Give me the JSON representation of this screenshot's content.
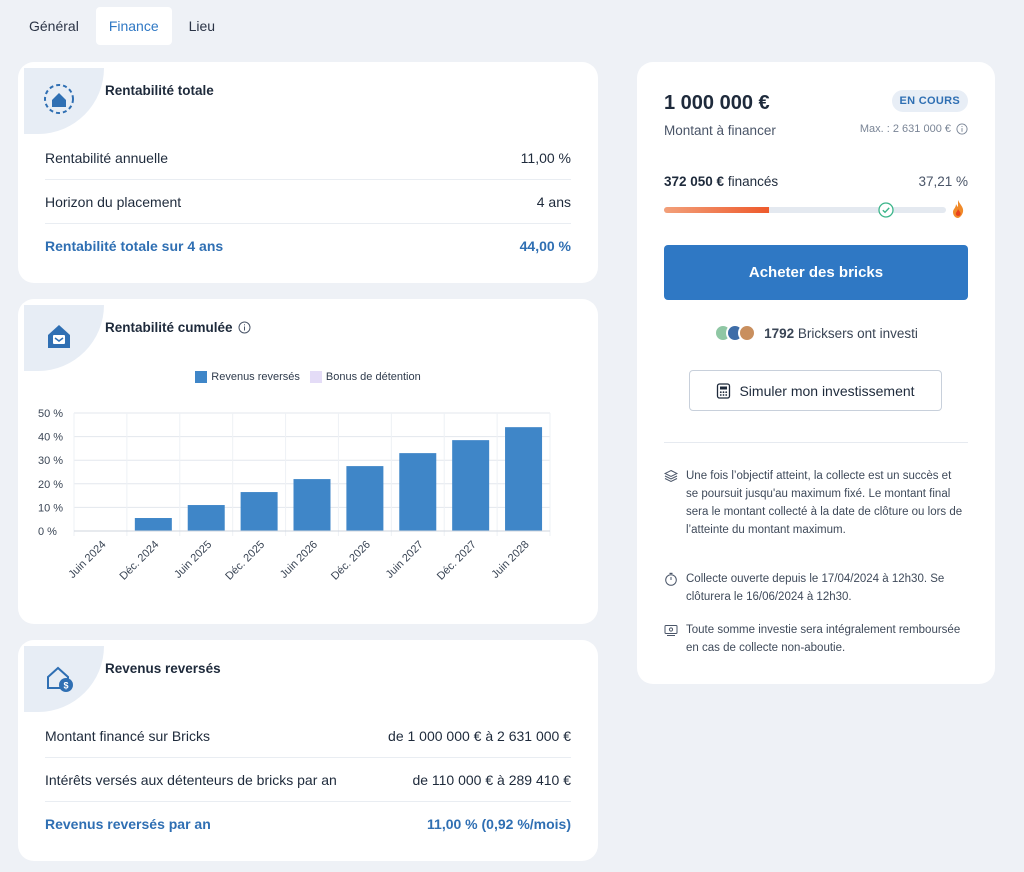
{
  "tabs": [
    {
      "label": "Général"
    },
    {
      "label": "Finance"
    },
    {
      "label": "Lieu"
    }
  ],
  "rentabilite": {
    "title": "Rentabilité totale",
    "rows": [
      {
        "label": "Rentabilité annuelle",
        "value": "11,00 %"
      },
      {
        "label": "Horizon du placement",
        "value": "4 ans"
      },
      {
        "label": "Rentabilité totale sur 4 ans",
        "value": "44,00 %"
      }
    ]
  },
  "cumulee": {
    "title": "Rentabilité cumulée",
    "info_icon": "info-circle-icon"
  },
  "chart_data": {
    "type": "bar",
    "categories": [
      "Juin 2024",
      "Déc. 2024",
      "Juin 2025",
      "Déc. 2025",
      "Juin 2026",
      "Déc. 2026",
      "Juin 2027",
      "Déc. 2027",
      "Juin 2028"
    ],
    "series": [
      {
        "name": "Revenus reversés",
        "color": "#3f86c8",
        "values": [
          0,
          5.5,
          11,
          16.5,
          22,
          27.5,
          33,
          38.5,
          44
        ]
      },
      {
        "name": "Bonus de détention",
        "color": "#e4dcf7",
        "values": [
          0,
          0,
          0,
          0,
          0,
          0,
          0,
          0,
          0
        ]
      }
    ],
    "y_ticks": [
      "0 %",
      "10 %",
      "20 %",
      "30 %",
      "40 %",
      "50 %"
    ],
    "ylim": [
      0,
      50
    ],
    "grid": true,
    "legend": "top-center"
  },
  "revenus": {
    "title": "Revenus reversés",
    "rows": [
      {
        "label": "Montant financé sur Bricks",
        "value": "de 1 000 000 € à 2 631 000 €"
      },
      {
        "label": "Intérêts versés aux détenteurs de bricks par an",
        "value": "de 110 000 € à 289 410 €"
      },
      {
        "label": "Revenus reversés par an",
        "value": "11,00 % (0,92 %/mois)"
      }
    ]
  },
  "funding": {
    "amount": "1 000 000 €",
    "status": "EN COURS",
    "amount_label": "Montant à financer",
    "max_label": "Max. : 2 631 000 €",
    "funded_amount": "372 050 €",
    "funded_suffix": "financés",
    "funded_pct_text": "37,21 %",
    "progress": 0.3721,
    "buy_button": "Acheter des bricks",
    "investors_count": "1792",
    "investors_text": "Bricksers ont investi",
    "simulate_button": "Simuler mon investissement",
    "info": [
      {
        "icon": "layers-icon",
        "text": "Une fois l’objectif atteint, la collecte est un succès et se poursuit jusqu'au maximum fixé. Le montant final sera le montant collecté à la date de clôture ou lors de l’atteinte du montant maximum."
      },
      {
        "icon": "stopwatch-icon",
        "text": "Collecte ouverte depuis le 17/04/2024 à 12h30. Se clôturera le 16/06/2024 à 12h30."
      },
      {
        "icon": "refund-icon",
        "text": "Toute somme investie sera intégralement remboursée en cas de collecte non-aboutie."
      }
    ],
    "colors": {
      "accent": "#2f78c4",
      "progress_start": "#f2a07a",
      "progress_end": "#ee5a2c",
      "check": "#3bb58a"
    }
  }
}
